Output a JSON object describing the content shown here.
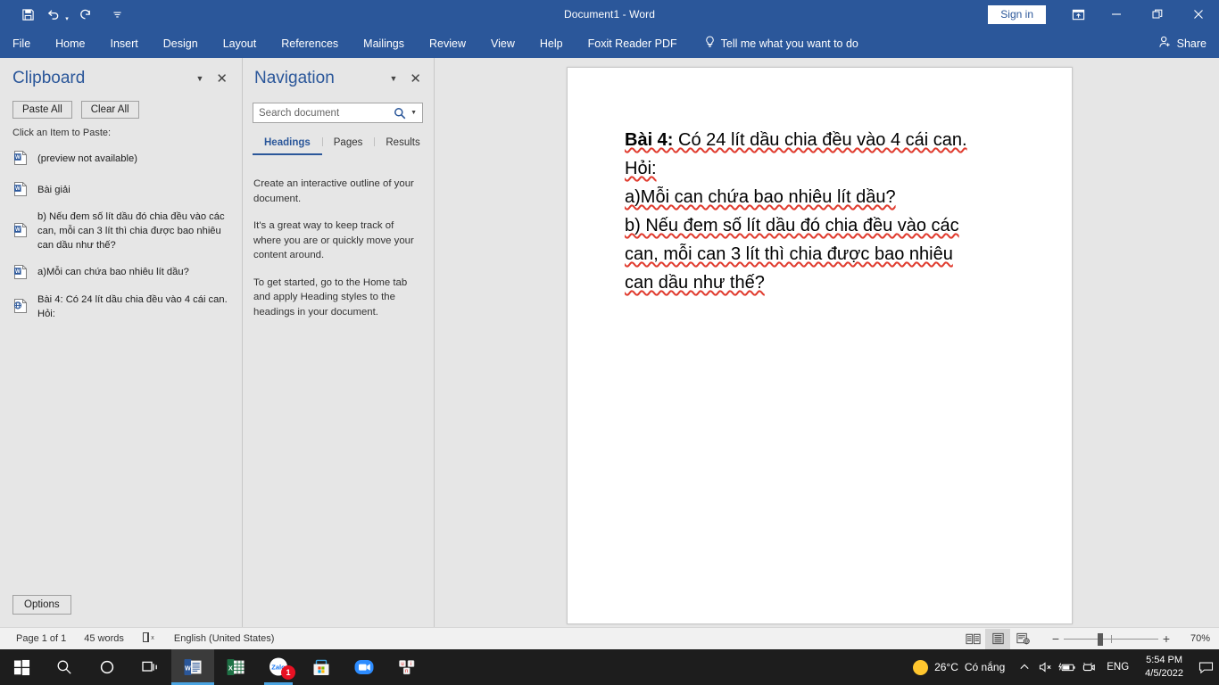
{
  "titlebar": {
    "document_title": "Document1  -  Word",
    "quick_access": [
      {
        "name": "save",
        "icon": "save-icon"
      },
      {
        "name": "undo",
        "icon": "undo-icon"
      },
      {
        "name": "redo",
        "icon": "redo-icon"
      },
      {
        "name": "customize-quick-access-toolbar",
        "icon": "more-icon"
      }
    ],
    "sign_in_label": "Sign in",
    "ribbon_display_options_tooltip": "Ribbon Display Options",
    "minimize_glyph": "–",
    "restore_glyph": "❐",
    "close_glyph": "✕"
  },
  "ribbon": {
    "tabs": [
      {
        "label": "File"
      },
      {
        "label": "Home"
      },
      {
        "label": "Insert"
      },
      {
        "label": "Design"
      },
      {
        "label": "Layout"
      },
      {
        "label": "References"
      },
      {
        "label": "Mailings"
      },
      {
        "label": "Review"
      },
      {
        "label": "View"
      },
      {
        "label": "Help"
      },
      {
        "label": "Foxit Reader PDF"
      }
    ],
    "tell_me": "Tell me what you want to do",
    "share": "Share"
  },
  "clipboard": {
    "title": "Clipboard",
    "paste_all": "Paste All",
    "clear_all": "Clear All",
    "hint": "Click an Item to Paste:",
    "options": "Options",
    "items": [
      {
        "icon": "word-document-icon",
        "text": "(preview not available)"
      },
      {
        "icon": "word-document-icon",
        "text": "Bài giải"
      },
      {
        "icon": "word-document-icon",
        "text": "b) Nếu đem số lít dầu đó chia đều vào các can, mỗi can 3 lít thì chia được bao nhiêu can dầu như thế?"
      },
      {
        "icon": "word-document-icon",
        "text": "a)Mỗi can chứa bao nhiêu lít dầu?"
      },
      {
        "icon": "html-document-icon",
        "text": "Bài 4: Có 24 lít dầu chia đều vào 4 cái can. Hỏi:"
      }
    ]
  },
  "navigation": {
    "title": "Navigation",
    "search_placeholder": "Search document",
    "search_value": "",
    "tabs": [
      {
        "label": "Headings",
        "active": true
      },
      {
        "label": "Pages",
        "active": false
      },
      {
        "label": "Results",
        "active": false
      }
    ],
    "body": [
      "Create an interactive outline of your document.",
      "It's a great way to keep track of where you are or quickly move your content around.",
      "To get started, go to the Home tab and apply Heading styles to the headings in your document."
    ]
  },
  "document": {
    "lines": [
      {
        "bold_prefix": "Bài 4:",
        "rest": " Có 24 lít dầu chia đều vào 4 cái can."
      },
      {
        "bold_prefix": "",
        "rest": "Hỏi:"
      },
      {
        "bold_prefix": "",
        "rest": "a)Mỗi can chứa bao nhiêu lít dầu?"
      },
      {
        "bold_prefix": "",
        "rest": "b) Nếu đem số lít dầu đó chia đều vào các"
      },
      {
        "bold_prefix": "",
        "rest": "can, mỗi can 3 lít thì chia được bao nhiêu"
      },
      {
        "bold_prefix": "",
        "rest": "can dầu như thế?"
      }
    ]
  },
  "statusbar": {
    "page": "Page 1 of 1",
    "words": "45 words",
    "proofing_icon": "spell-check-icon",
    "language": "English (United States)",
    "views": [
      {
        "name": "read-mode-view-button",
        "active": false
      },
      {
        "name": "print-layout-view-button",
        "active": true
      },
      {
        "name": "web-layout-view-button",
        "active": false
      }
    ],
    "zoom_out": "−",
    "zoom_in": "+",
    "zoom_level": "70%"
  },
  "taskbar": {
    "items": [
      {
        "name": "start-button",
        "icon": "windows-logo-icon"
      },
      {
        "name": "search-button",
        "icon": "search-icon"
      },
      {
        "name": "cortana-button",
        "icon": "cortana-circle-icon"
      },
      {
        "name": "task-view-button",
        "icon": "task-view-icon"
      },
      {
        "name": "word-taskbar-button",
        "icon": "word-icon",
        "active": true,
        "running": true
      },
      {
        "name": "excel-taskbar-button",
        "icon": "excel-icon",
        "running": false
      },
      {
        "name": "zalo-taskbar-button",
        "icon": "zalo-icon",
        "running": true,
        "badge": "1"
      },
      {
        "name": "microsoft-store-taskbar-button",
        "icon": "store-icon"
      },
      {
        "name": "zoom-taskbar-button",
        "icon": "zoom-camera-icon"
      },
      {
        "name": "unikey-taskbar-button",
        "icon": "unikey-icon"
      }
    ],
    "tray": {
      "weather_temp": "26°C",
      "weather_desc": "Có nắng",
      "show_hidden_glyph": "∧",
      "volume_icon": "volume-muted-icon",
      "battery_icon": "battery-charging-icon",
      "camera_icon": "camera-icon",
      "language": "ENG",
      "time": "5:54 PM",
      "date": "4/5/2022",
      "action_center_icon": "notification-icon"
    }
  },
  "colors": {
    "word_blue": "#2b579a",
    "accent": "#2b579a",
    "taskbar": "#1d1d1d",
    "squiggle": "#e03b2e"
  }
}
